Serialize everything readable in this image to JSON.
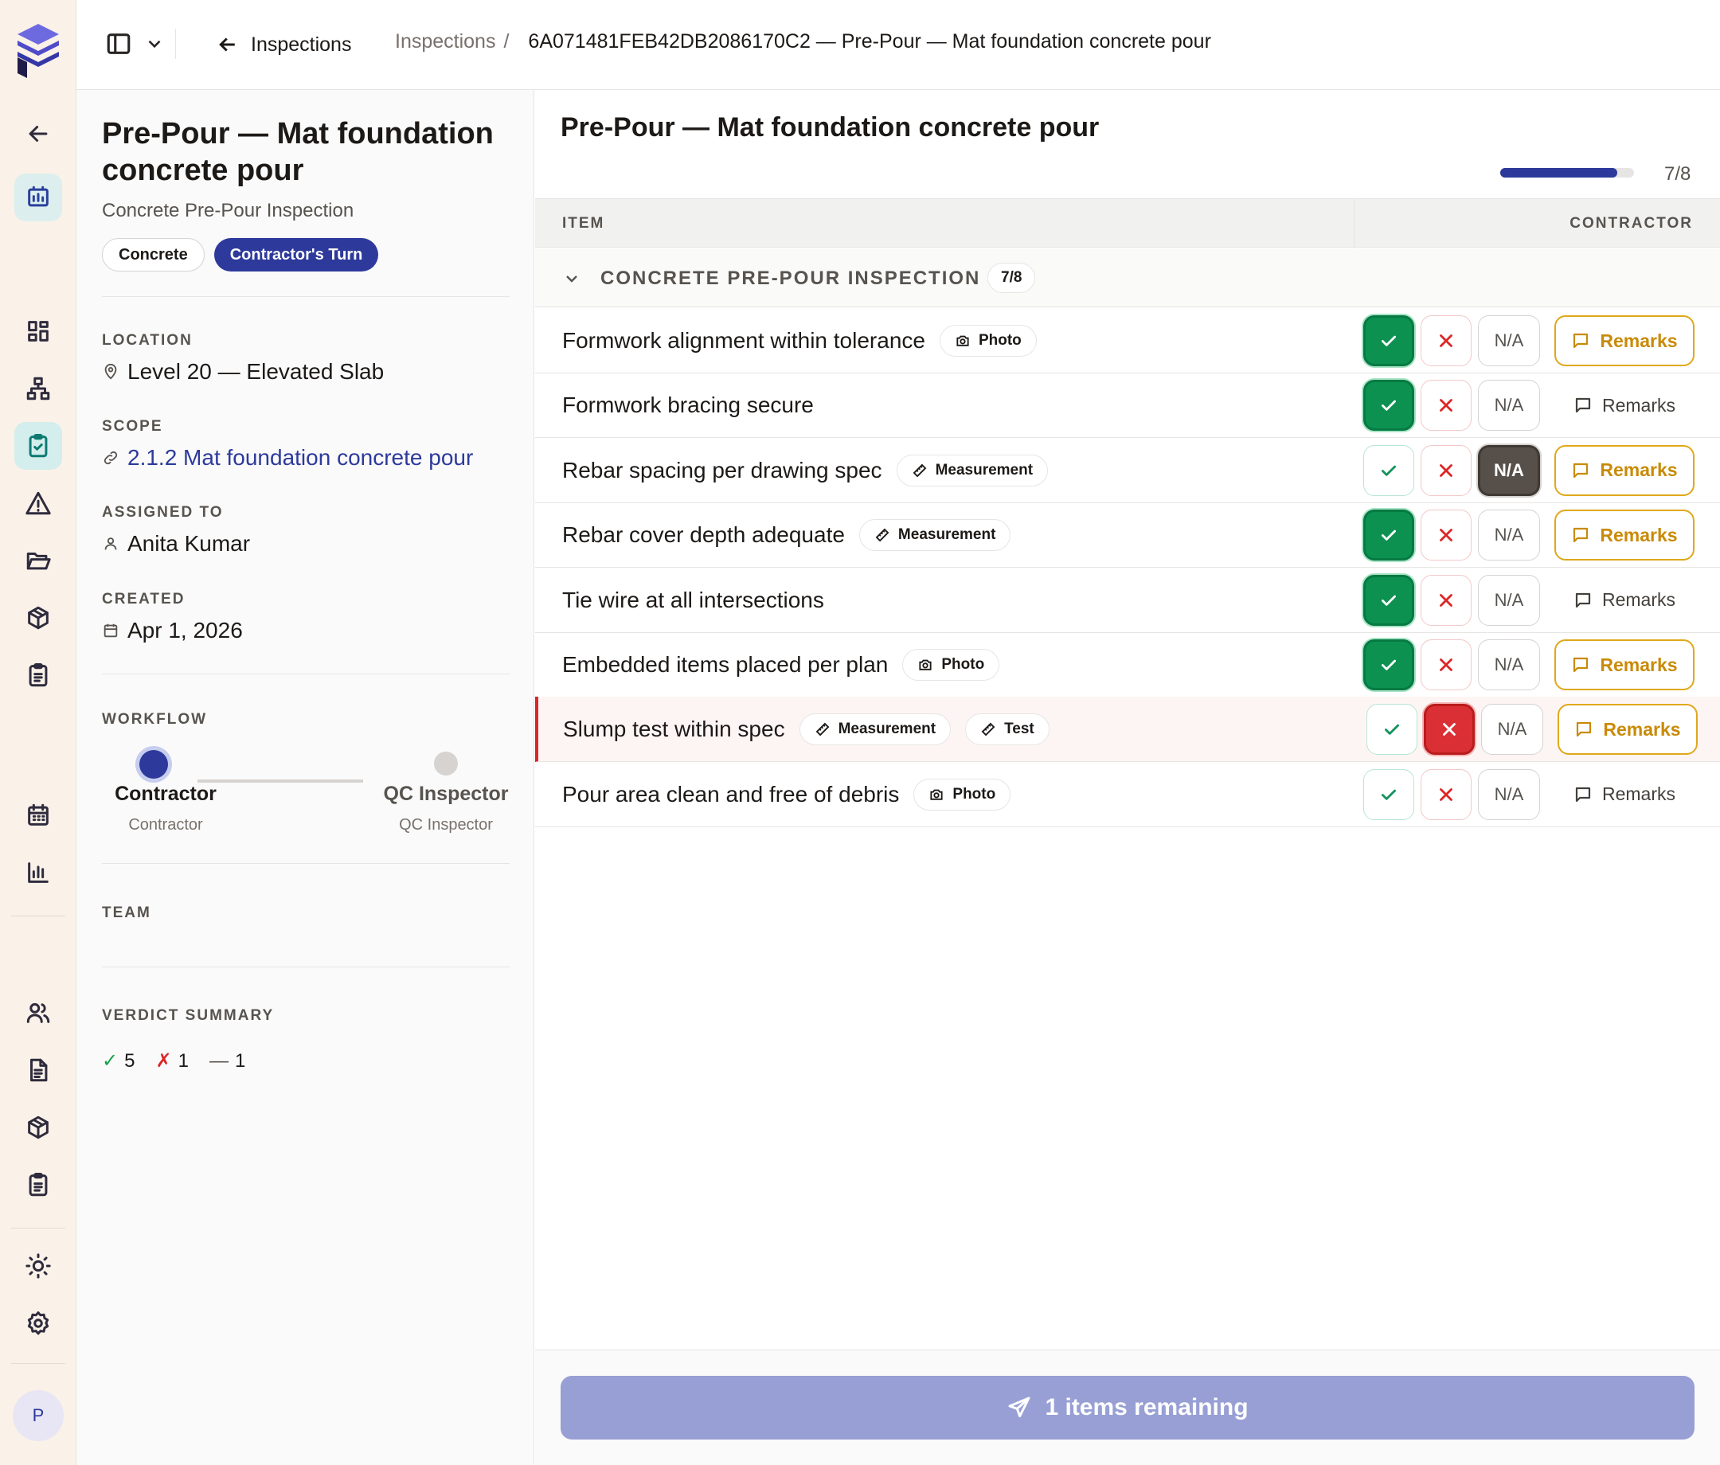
{
  "topbar": {
    "back_label": "Inspections",
    "crumb_root": "Inspections",
    "crumb_sep": "/",
    "crumb_current": "6A071481FEB42DB2086170C2 — Pre-Pour — Mat foundation concrete pour"
  },
  "sidebar": {
    "avatar_initial": "P",
    "icons": [
      "back-arrow-icon",
      "dashboard-icon",
      "grid-icon",
      "hierarchy-icon",
      "clipboard-check-icon",
      "warning-icon",
      "folder-icon",
      "package-icon",
      "checklist-icon",
      "calendar-icon",
      "bar-chart-icon",
      "users-icon",
      "document-icon",
      "package-icon",
      "checklist-icon",
      "sun-icon",
      "settings-icon"
    ]
  },
  "details": {
    "title": "Pre-Pour — Mat foundation concrete pour",
    "subtitle": "Concrete Pre-Pour Inspection",
    "tags": [
      "Concrete",
      "Contractor's Turn"
    ],
    "location_label": "LOCATION",
    "location": "Level 20 — Elevated Slab",
    "scope_label": "SCOPE",
    "scope": "2.1.2 Mat foundation concrete pour",
    "assigned_label": "ASSIGNED TO",
    "assigned": "Anita Kumar",
    "created_label": "CREATED",
    "created": "Apr 1, 2026",
    "workflow_label": "WORKFLOW",
    "workflow": [
      {
        "name": "Contractor",
        "role": "Contractor",
        "active": true
      },
      {
        "name": "QC Inspector",
        "role": "QC Inspector",
        "active": false
      }
    ],
    "team_label": "TEAM",
    "verdict_label": "VERDICT SUMMARY",
    "verdict": {
      "pass_symbol": "✓",
      "pass": "5",
      "fail_symbol": "✗",
      "fail": "1",
      "na_symbol": "—",
      "na": "1"
    }
  },
  "checklist": {
    "title": "Pre-Pour — Mat foundation concrete pour",
    "progress_text": "7/8",
    "progress_fraction": 0.875,
    "col_item": "ITEM",
    "col_contractor": "CONTRACTOR",
    "section_title": "CONCRETE PRE-POUR INSPECTION",
    "section_count": "7/8",
    "na_label": "N/A",
    "remarks_label": "Remarks",
    "items": [
      {
        "label": "Formwork alignment within tolerance",
        "tags": [
          {
            "icon": "camera-icon",
            "text": "Photo"
          }
        ],
        "verdict": "pass",
        "remarks_active": true
      },
      {
        "label": "Formwork bracing secure",
        "tags": [],
        "verdict": "pass",
        "remarks_active": false
      },
      {
        "label": "Rebar spacing per drawing spec",
        "tags": [
          {
            "icon": "ruler-icon",
            "text": "Measurement"
          }
        ],
        "verdict": "na",
        "remarks_active": true
      },
      {
        "label": "Rebar cover depth adequate",
        "tags": [
          {
            "icon": "ruler-icon",
            "text": "Measurement"
          }
        ],
        "verdict": "pass",
        "remarks_active": true
      },
      {
        "label": "Tie wire at all intersections",
        "tags": [],
        "verdict": "pass",
        "remarks_active": false
      },
      {
        "label": "Embedded items placed per plan",
        "tags": [
          {
            "icon": "camera-icon",
            "text": "Photo"
          }
        ],
        "verdict": "pass",
        "remarks_active": true
      },
      {
        "label": "Slump test within spec",
        "tags": [
          {
            "icon": "ruler-icon",
            "text": "Measurement"
          },
          {
            "icon": "ruler-icon",
            "text": "Test"
          }
        ],
        "verdict": "fail",
        "remarks_active": true
      },
      {
        "label": "Pour area clean and free of debris",
        "tags": [
          {
            "icon": "camera-icon",
            "text": "Photo"
          }
        ],
        "verdict": "none",
        "remarks_active": false
      }
    ],
    "submit_label": "1 items remaining"
  },
  "colors": {
    "brand": "#2d3a9b",
    "pass": "#0c9151",
    "fail": "#db2f36",
    "na": "#57504a",
    "remarks": "#e0a81a",
    "submit_disabled": "#989fd4"
  }
}
